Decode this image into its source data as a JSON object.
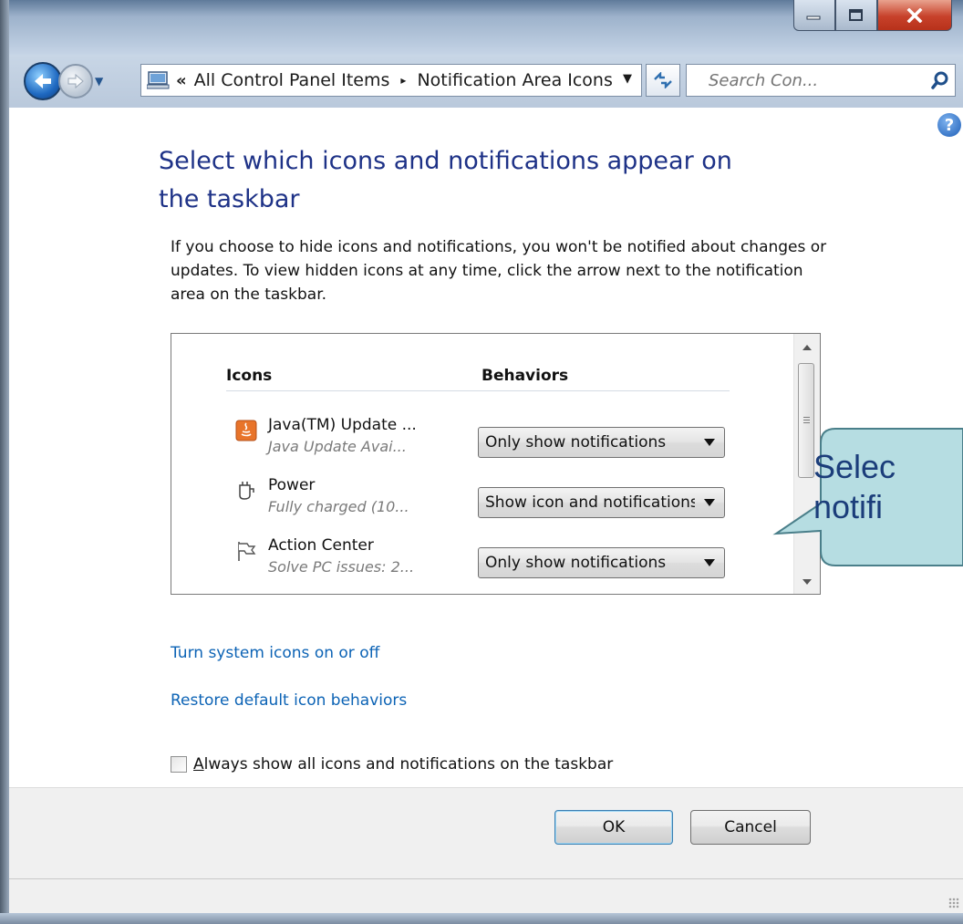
{
  "window": {
    "caption_buttons": [
      "minimize",
      "maximize",
      "close"
    ]
  },
  "address_bar": {
    "chevron": "«",
    "breadcrumbs": [
      "All Control Panel Items",
      "Notification Area Icons"
    ],
    "separator": "▸"
  },
  "search": {
    "placeholder": "Search Con..."
  },
  "help": {
    "label": "?"
  },
  "page": {
    "heading": "Select which icons and notifications appear on the taskbar",
    "description": "If you choose to hide icons and notifications, you won't be notified about changes or updates. To view hidden icons at any time, click the arrow next to the notification area on the taskbar."
  },
  "list": {
    "columns": {
      "icons": "Icons",
      "behaviors": "Behaviors"
    },
    "rows": [
      {
        "name": "Java(TM) Update ...",
        "subtitle": "Java Update Avai...",
        "behavior": "Only show notifications",
        "icon": "java-icon"
      },
      {
        "name": "Power",
        "subtitle": "Fully charged (10...",
        "behavior": "Show icon and notifications",
        "icon": "power-plug-icon"
      },
      {
        "name": "Action Center",
        "subtitle": "Solve PC issues: 2...",
        "behavior": "Only show notifications",
        "icon": "flag-icon"
      }
    ]
  },
  "links": {
    "turn_system_icons": "Turn system icons on or off",
    "restore_defaults": "Restore default icon behaviors"
  },
  "checkbox": {
    "label_accel": "A",
    "label_rest": "lways show all icons and notifications on the taskbar",
    "checked": false
  },
  "buttons": {
    "ok": "OK",
    "cancel": "Cancel"
  },
  "callout": {
    "line1": "Selec",
    "line2": "notifi",
    "fill": "#b6dde2",
    "stroke": "#4a7f8a"
  },
  "colors": {
    "heading": "#1e3287",
    "link": "#0c63b5"
  }
}
